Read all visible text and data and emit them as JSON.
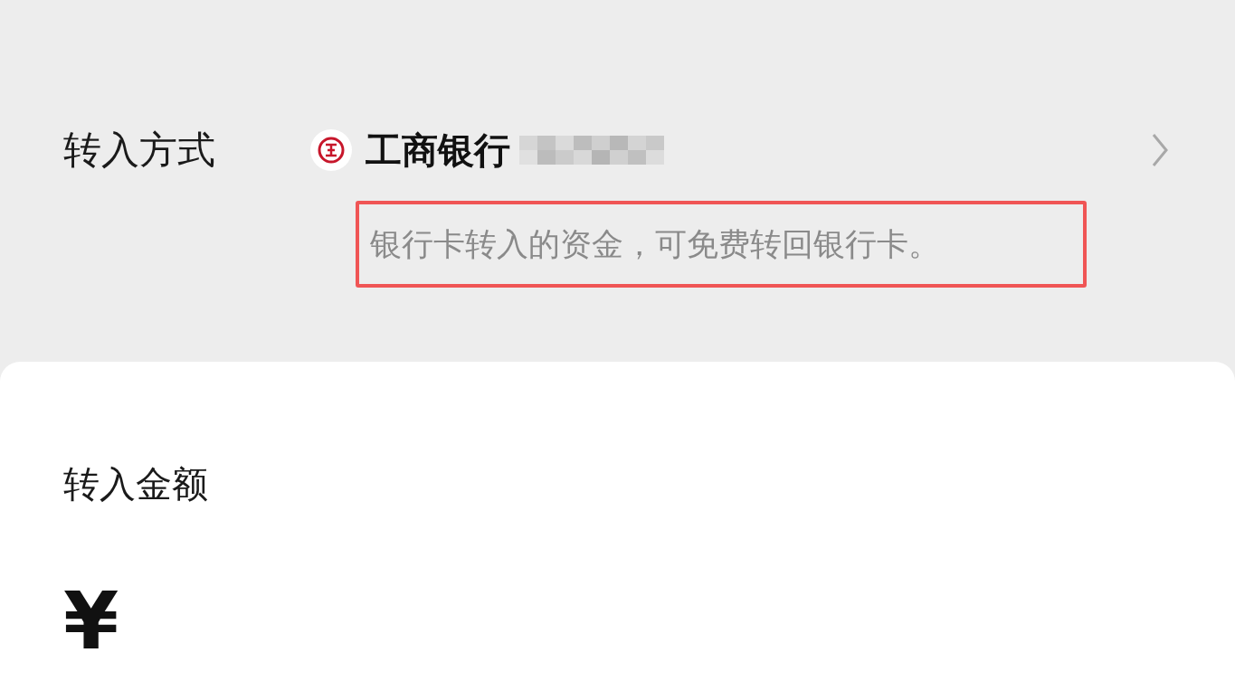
{
  "transfer_method": {
    "label": "转入方式",
    "bank_name": "工商银行",
    "hint": "银行卡转入的资金，可免费转回银行卡。",
    "hint_highlighted": true
  },
  "amount": {
    "label": "转入金额",
    "currency": "¥"
  }
}
